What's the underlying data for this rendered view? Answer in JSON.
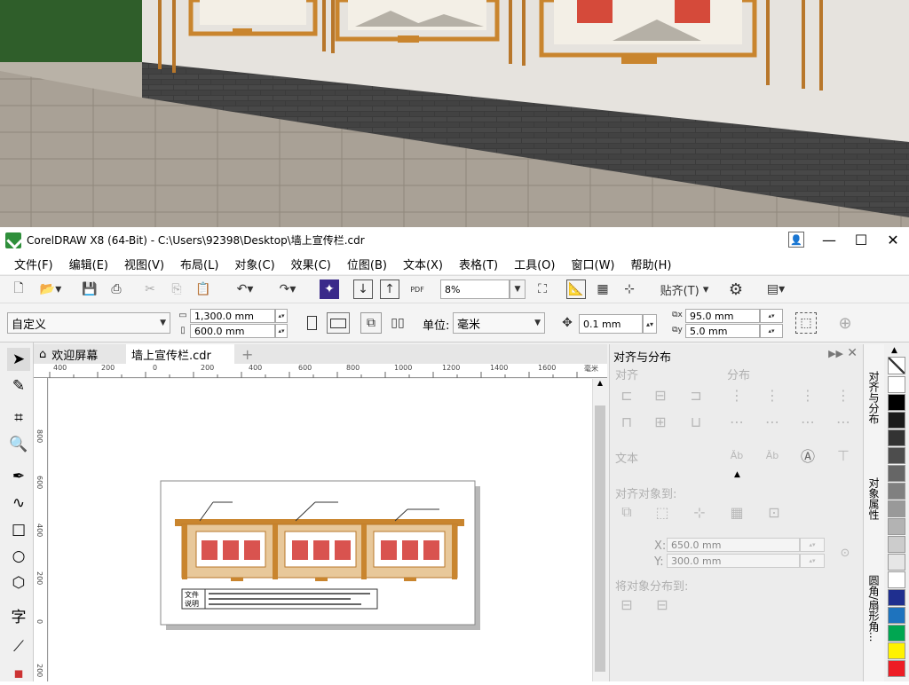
{
  "window": {
    "title": "CorelDRAW X8 (64-Bit) - C:\\Users\\92398\\Desktop\\墙上宣传栏.cdr",
    "controls": [
      "—",
      "☐",
      "✕"
    ]
  },
  "menu": [
    "文件(F)",
    "编辑(E)",
    "视图(V)",
    "布局(L)",
    "对象(C)",
    "效果(C)",
    "位图(B)",
    "文本(X)",
    "表格(T)",
    "工具(O)",
    "窗口(W)",
    "帮助(H)"
  ],
  "toolbar": {
    "zoom": "8%",
    "snap_label": "贴齐(T)",
    "pdf_label": "PDF"
  },
  "propbar": {
    "page_preset": "自定义",
    "width": "1,300.0 mm",
    "height": "600.0 mm",
    "unit_label": "单位:",
    "unit_value": "毫米",
    "nudge": "0.1 mm",
    "dup_x": "95.0 mm",
    "dup_y": "5.0 mm"
  },
  "doc_tabs": {
    "welcome": "欢迎屏幕",
    "file": "墙上宣传栏.cdr",
    "add": "+"
  },
  "ruler": {
    "h_ticks": [
      "400",
      "200",
      "0",
      "200",
      "400",
      "600",
      "800",
      "1000",
      "1200",
      "1400",
      "1600"
    ],
    "v_ticks": [
      "800",
      "600",
      "400",
      "200",
      "0",
      "200"
    ],
    "unit": "毫米"
  },
  "drawing": {
    "note_label_1": "文件",
    "note_label_2": "说明"
  },
  "panel": {
    "title": "对齐与分布",
    "align": "对齐",
    "distribute": "分布",
    "text": "文本",
    "align_to": "对齐对象到:",
    "x_label": "X:",
    "x_value": "650.0 mm",
    "y_label": "Y:",
    "y_value": "300.0 mm",
    "distribute_to": "将对象分布到:"
  },
  "dock_tabs": [
    "对齐与分布",
    "对象属性",
    "圆角/扇形角..."
  ],
  "palette": [
    "#ffffff",
    "#000000",
    "#1a1a1a",
    "#333333",
    "#4d4d4d",
    "#666666",
    "#808080",
    "#999999",
    "#b3b3b3",
    "#cccccc",
    "#e6e6e6",
    "#ffffff",
    "#1f2f8f",
    "#1e73be",
    "#00a651",
    "#fff200",
    "#ed1c24"
  ],
  "photo_colors": {
    "wall": "#e8e5df",
    "brick": "#3a3a3a",
    "frame": "#c9852e",
    "grass": "#2e5b27",
    "paving": "#a89f93"
  }
}
